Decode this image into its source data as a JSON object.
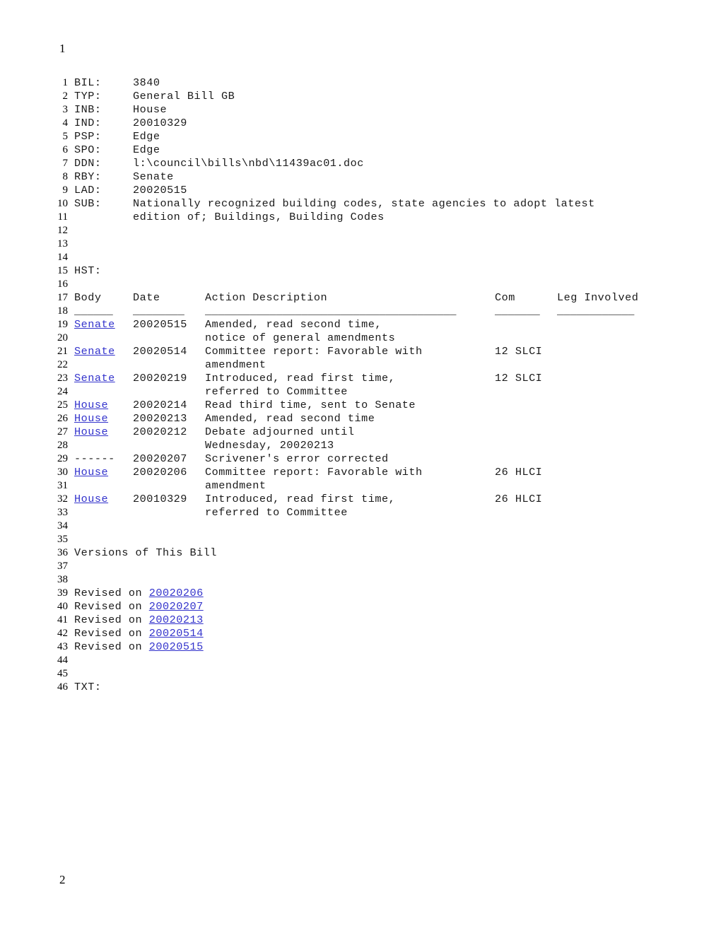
{
  "document": {
    "page_marker_top": "1",
    "page_marker_bottom": "2"
  },
  "header_fields": [
    {
      "line": "1",
      "label": "BIL:",
      "value": "3840"
    },
    {
      "line": "2",
      "label": "TYP:",
      "value": "General Bill GB"
    },
    {
      "line": "3",
      "label": "INB:",
      "value": "House"
    },
    {
      "line": "4",
      "label": "IND:",
      "value": "20010329"
    },
    {
      "line": "5",
      "label": "PSP:",
      "value": "Edge"
    },
    {
      "line": "6",
      "label": "SPO:",
      "value": "Edge"
    },
    {
      "line": "7",
      "label": "DDN:",
      "value": "l:\\council\\bills\\nbd\\11439ac01.doc"
    },
    {
      "line": "8",
      "label": "RBY:",
      "value": "Senate"
    },
    {
      "line": "9",
      "label": "LAD:",
      "value": "20020515"
    },
    {
      "line": "10",
      "label": "SUB:",
      "value": "Nationally recognized building codes, state agencies to adopt latest"
    },
    {
      "line": "11",
      "label": "",
      "value": "edition of; Buildings, Building Codes"
    }
  ],
  "blank_lines_a": [
    "12",
    "13",
    "14"
  ],
  "hst": {
    "line": "15",
    "label": "HST:",
    "blank_line": "16",
    "header_line": "17",
    "rule_line": "18",
    "columns": {
      "body": "Body",
      "date": "Date",
      "action": "Action Description",
      "com": "Com",
      "leg": "Leg Involved"
    },
    "rules": {
      "body": "______",
      "date": "________",
      "action": "_______________________________________",
      "com": "_______",
      "leg": "____________"
    },
    "rows": [
      {
        "line": "19",
        "body": "Senate",
        "body_link": true,
        "date": "20020515",
        "action": "Amended, read second time,",
        "com": "",
        "leg": ""
      },
      {
        "line": "20",
        "body": "",
        "body_link": false,
        "date": "",
        "action": "notice of general amendments",
        "com": "",
        "leg": ""
      },
      {
        "line": "21",
        "body": "Senate",
        "body_link": true,
        "date": "20020514",
        "action": "Committee report: Favorable with",
        "com": "12 SLCI",
        "leg": ""
      },
      {
        "line": "22",
        "body": "",
        "body_link": false,
        "date": "",
        "action": "amendment",
        "com": "",
        "leg": ""
      },
      {
        "line": "23",
        "body": "Senate",
        "body_link": true,
        "date": "20020219",
        "action": "Introduced, read first time,",
        "com": "12 SLCI",
        "leg": ""
      },
      {
        "line": "24",
        "body": "",
        "body_link": false,
        "date": "",
        "action": "referred to Committee",
        "com": "",
        "leg": ""
      },
      {
        "line": "25",
        "body": "House",
        "body_link": true,
        "date": "20020214",
        "action": "Read third time, sent to Senate",
        "com": "",
        "leg": ""
      },
      {
        "line": "26",
        "body": "House",
        "body_link": true,
        "date": "20020213",
        "action": "Amended, read second time",
        "com": "",
        "leg": ""
      },
      {
        "line": "27",
        "body": "House",
        "body_link": true,
        "date": "20020212",
        "action": "Debate adjourned until",
        "com": "",
        "leg": ""
      },
      {
        "line": "28",
        "body": "",
        "body_link": false,
        "date": "",
        "action": "Wednesday, 20020213",
        "com": "",
        "leg": ""
      },
      {
        "line": "29",
        "body": "------",
        "body_link": false,
        "date": "20020207",
        "action": "Scrivener's error corrected",
        "com": "",
        "leg": ""
      },
      {
        "line": "30",
        "body": "House",
        "body_link": true,
        "date": "20020206",
        "action": "Committee report: Favorable with",
        "com": "26 HLCI",
        "leg": ""
      },
      {
        "line": "31",
        "body": "",
        "body_link": false,
        "date": "",
        "action": "amendment",
        "com": "",
        "leg": ""
      },
      {
        "line": "32",
        "body": "House",
        "body_link": true,
        "date": "20010329",
        "action": "Introduced, read first time,",
        "com": "26 HLCI",
        "leg": ""
      },
      {
        "line": "33",
        "body": "",
        "body_link": false,
        "date": "",
        "action": "referred to Committee",
        "com": "",
        "leg": ""
      }
    ]
  },
  "blank_lines_b": [
    "34",
    "35"
  ],
  "versions": {
    "heading_line": "36",
    "heading": "Versions of This Bill",
    "blank_lines": [
      "37",
      "38"
    ],
    "prefix": "Revised on ",
    "items": [
      {
        "line": "39",
        "date": "20020206"
      },
      {
        "line": "40",
        "date": "20020207"
      },
      {
        "line": "41",
        "date": "20020213"
      },
      {
        "line": "42",
        "date": "20020514"
      },
      {
        "line": "43",
        "date": "20020515"
      }
    ]
  },
  "blank_lines_c": [
    "44",
    "45"
  ],
  "txt": {
    "line": "46",
    "label": "TXT:"
  },
  "colors": {
    "link": "#3333cc",
    "text": "#1a1a1a",
    "background": "#ffffff"
  }
}
